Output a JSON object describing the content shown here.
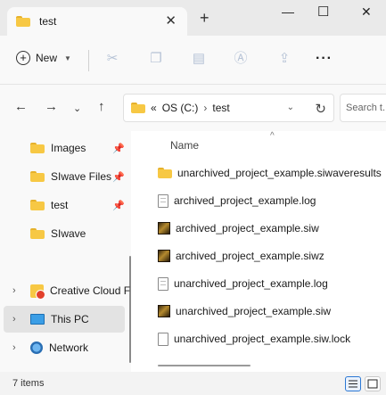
{
  "window": {
    "tab_title": "test",
    "tab_close": "✕",
    "new_tab": "+",
    "minimize": "—",
    "maximize": "☐",
    "close": "✕"
  },
  "toolbar": {
    "new_label": "New",
    "icons": [
      "cut-icon",
      "copy-icon",
      "paste-icon",
      "rename-icon",
      "share-icon",
      "delete-icon"
    ],
    "more": "···"
  },
  "address": {
    "overflow": "«",
    "segments": [
      "OS (C:)",
      "test"
    ],
    "separator": "›",
    "search_placeholder": "Search t..."
  },
  "sidebar": {
    "quick_access": [
      {
        "label": "Images",
        "icon": "folder-icon",
        "pinned": true
      },
      {
        "label": "SIwave Files",
        "icon": "folder-icon",
        "pinned": true
      },
      {
        "label": "test",
        "icon": "folder-icon",
        "pinned": true
      },
      {
        "label": "SIwave",
        "icon": "folder-icon",
        "pinned": false
      }
    ],
    "locations": [
      {
        "label": "Creative Cloud F",
        "icon": "creative-cloud-icon"
      },
      {
        "label": "This PC",
        "icon": "this-pc-icon",
        "selected": true
      },
      {
        "label": "Network",
        "icon": "network-icon"
      }
    ]
  },
  "files": {
    "column_name": "Name",
    "items": [
      {
        "name": "unarchived_project_example.siwaveresults",
        "icon": "folder-icon"
      },
      {
        "name": "archived_project_example.log",
        "icon": "text-file-icon"
      },
      {
        "name": "archived_project_example.siw",
        "icon": "siwave-file-icon"
      },
      {
        "name": "archived_project_example.siwz",
        "icon": "siwave-file-icon"
      },
      {
        "name": "unarchived_project_example.log",
        "icon": "text-file-icon"
      },
      {
        "name": "unarchived_project_example.siw",
        "icon": "siwave-file-icon"
      },
      {
        "name": "unarchived_project_example.siw.lock",
        "icon": "blank-file-icon"
      }
    ]
  },
  "status": {
    "item_count": "7 items",
    "view_mode": "details"
  },
  "colors": {
    "folder": "#f7c844",
    "window_bg": "#f3f3f3",
    "content_bg": "#ffffff",
    "selection": "#e3e3e3"
  }
}
